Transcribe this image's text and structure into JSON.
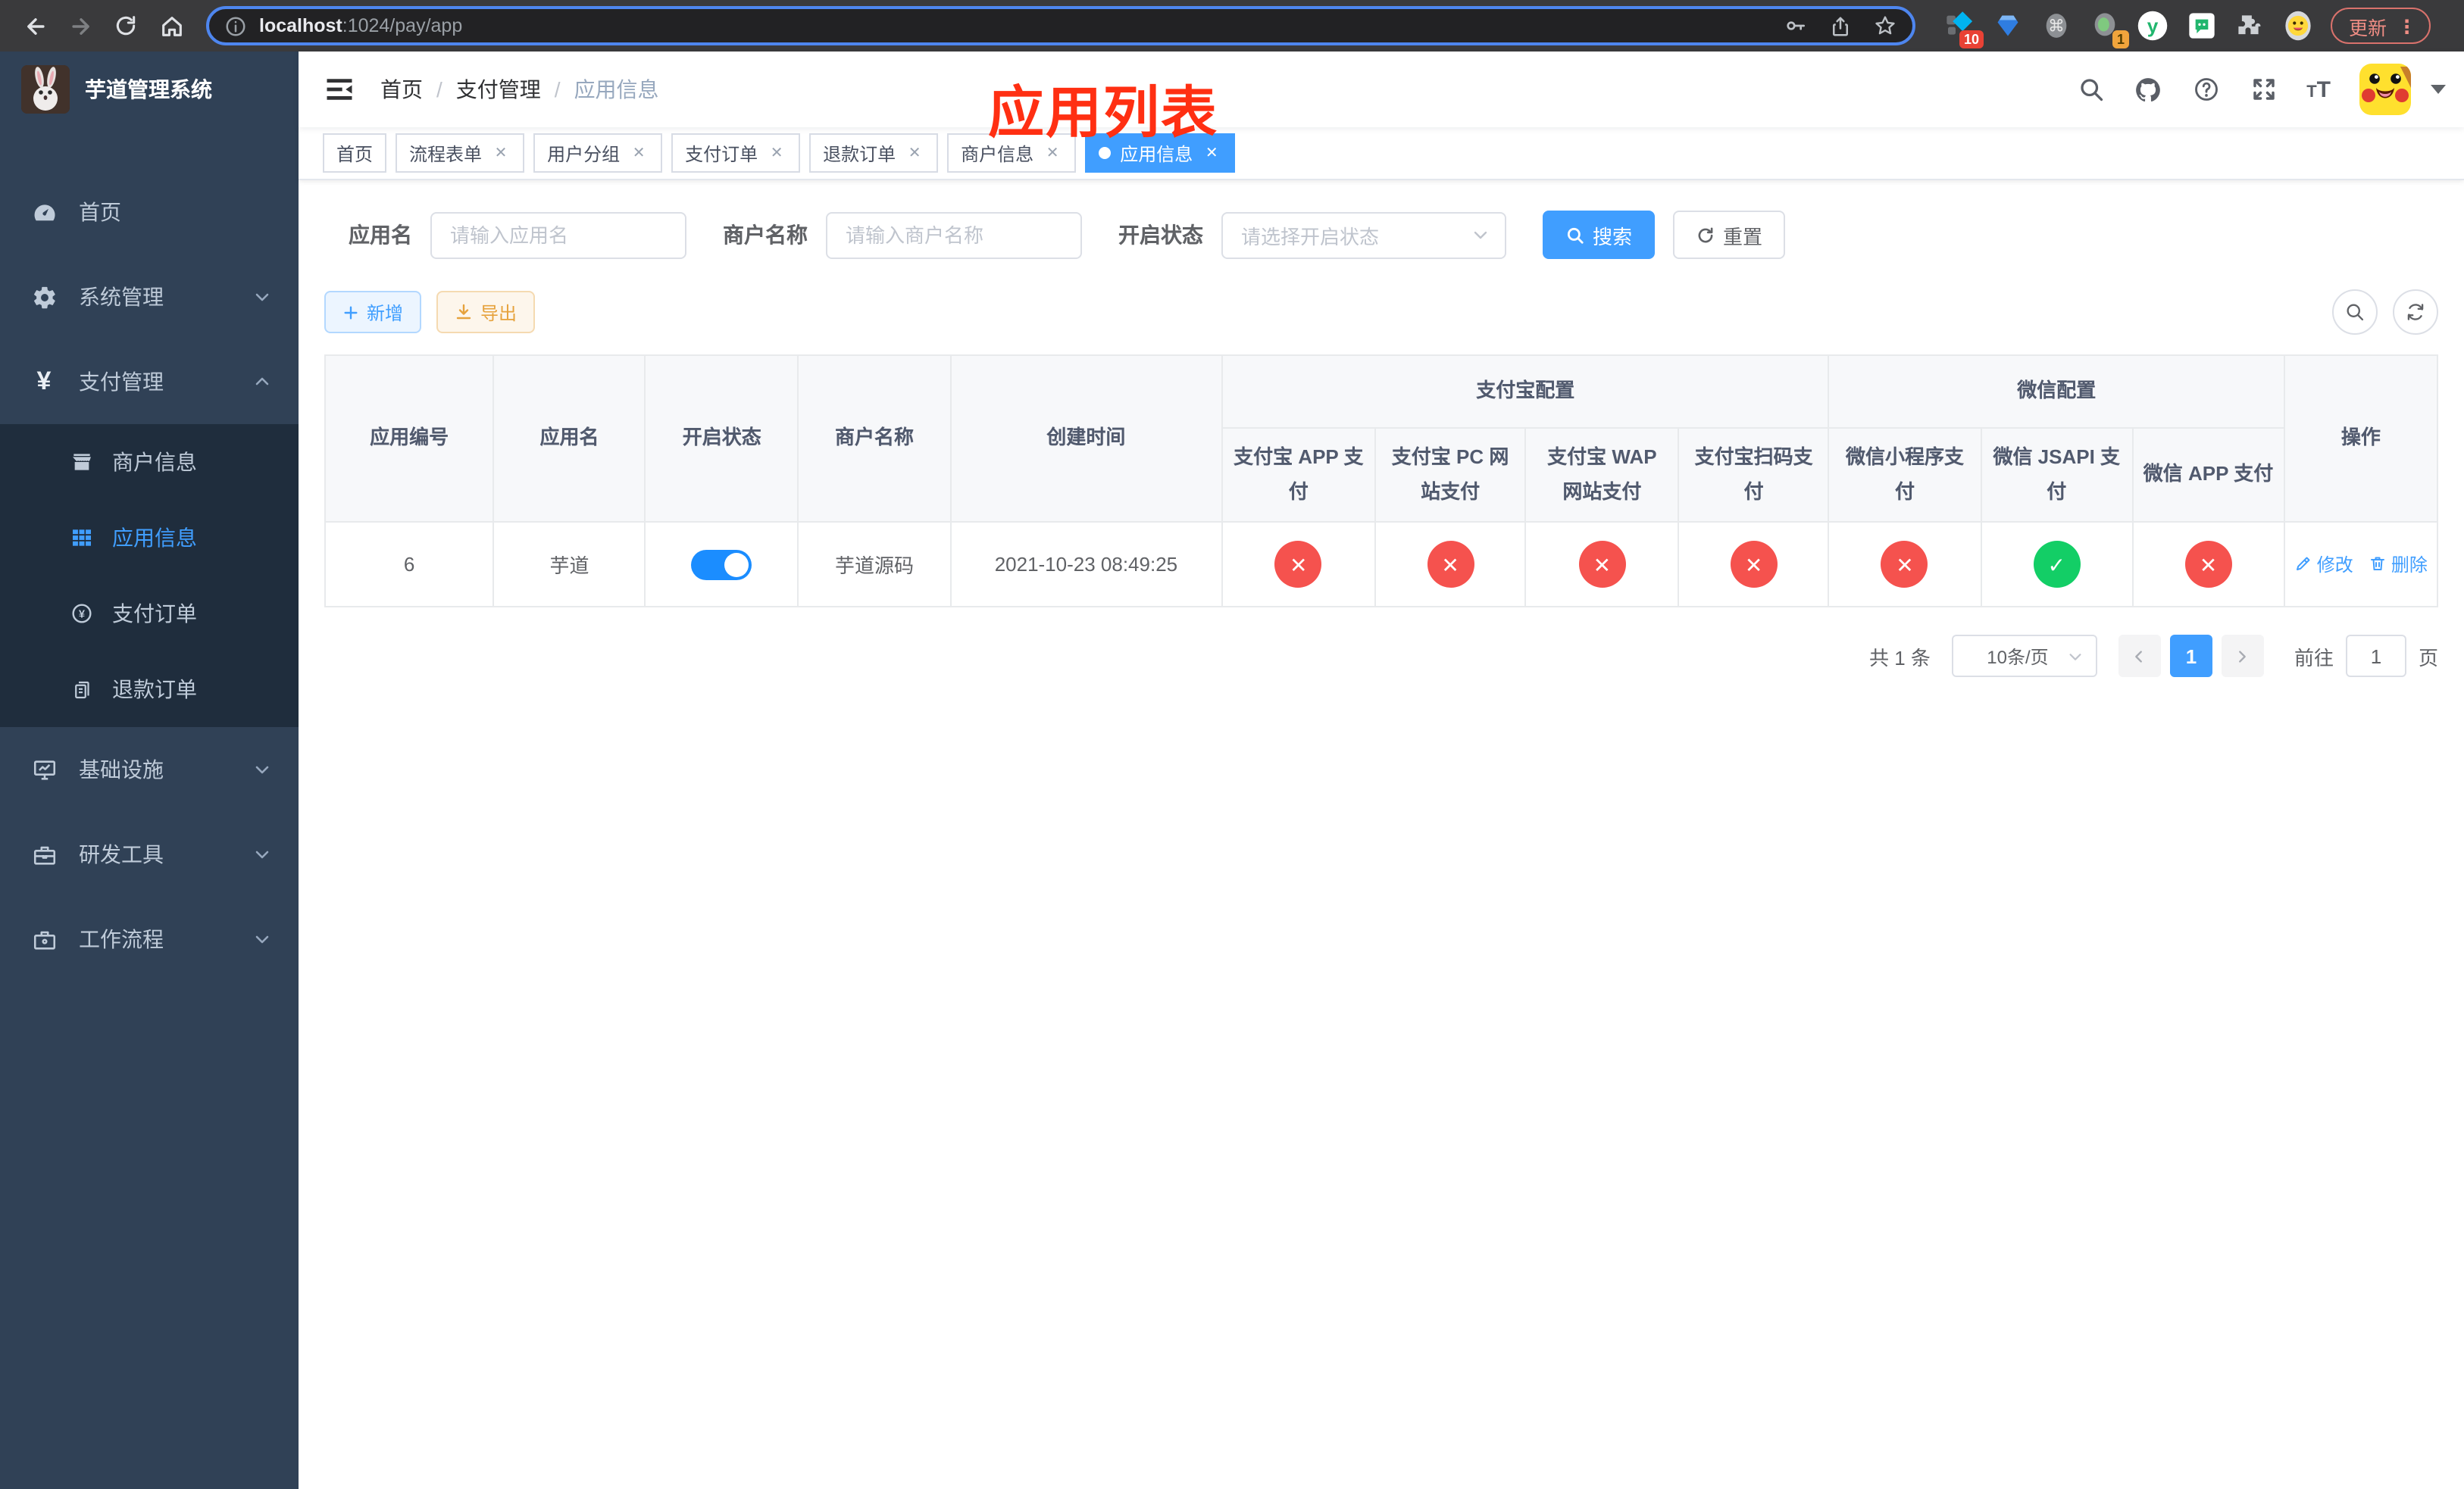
{
  "browser": {
    "url_host": "localhost",
    "url_rest": ":1024/pay/app",
    "update_label": "更新",
    "menu_dots": "⋮",
    "ext_badge_pin": "10",
    "ext_badge_one": "1"
  },
  "colors": {
    "accent": "#409eff",
    "success": "#13ce66",
    "danger": "#f5524e",
    "warning": "#e6a23c",
    "sidebar_bg": "#304156",
    "submenu_bg": "#1f2d3d",
    "annotation_red": "#ff2f12"
  },
  "sidebar": {
    "system_title": "芋道管理系统",
    "items": [
      {
        "label": "首页",
        "icon": "dashboard-icon",
        "chevron": null,
        "expanded": false
      },
      {
        "label": "系统管理",
        "icon": "gear-icon",
        "chevron": "down",
        "expanded": false
      },
      {
        "label": "支付管理",
        "icon": "yen-icon",
        "chevron": "up",
        "expanded": true
      },
      {
        "label": "基础设施",
        "icon": "infrastructure-icon",
        "chevron": "down",
        "expanded": false
      },
      {
        "label": "研发工具",
        "icon": "devtools-icon",
        "chevron": "down",
        "expanded": false
      },
      {
        "label": "工作流程",
        "icon": "workflow-icon",
        "chevron": "down",
        "expanded": false
      }
    ],
    "submenu": [
      {
        "label": "商户信息",
        "icon": "merchant-icon",
        "active": false
      },
      {
        "label": "应用信息",
        "icon": "app-grid-icon",
        "active": true
      },
      {
        "label": "支付订单",
        "icon": "pay-order-icon",
        "active": false
      },
      {
        "label": "退款订单",
        "icon": "refund-order-icon",
        "active": false
      }
    ]
  },
  "header": {
    "breadcrumb": [
      "首页",
      "支付管理",
      "应用信息"
    ],
    "annotation_title": "应用列表"
  },
  "tabs": [
    {
      "label": "首页",
      "closable": false,
      "active": false
    },
    {
      "label": "流程表单",
      "closable": true,
      "active": false
    },
    {
      "label": "用户分组",
      "closable": true,
      "active": false
    },
    {
      "label": "支付订单",
      "closable": true,
      "active": false
    },
    {
      "label": "退款订单",
      "closable": true,
      "active": false
    },
    {
      "label": "商户信息",
      "closable": true,
      "active": false
    },
    {
      "label": "应用信息",
      "closable": true,
      "active": true
    }
  ],
  "filters": {
    "app_name_label": "应用名",
    "app_name_placeholder": "请输入应用名",
    "merchant_label": "商户名称",
    "merchant_placeholder": "请输入商户名称",
    "status_label": "开启状态",
    "status_placeholder": "请选择开启状态",
    "search_label": "搜索",
    "reset_label": "重置"
  },
  "toolbar": {
    "add_label": "新增",
    "export_label": "导出"
  },
  "table": {
    "simple_columns": [
      "应用编号",
      "应用名",
      "开启状态",
      "商户名称",
      "创建时间"
    ],
    "groups": [
      {
        "label": "支付宝配置",
        "children": [
          "支付宝 APP 支付",
          "支付宝 PC 网站支付",
          "支付宝 WAP 网站支付",
          "支付宝扫码支付"
        ]
      },
      {
        "label": "微信配置",
        "children": [
          "微信小程序支付",
          "微信 JSAPI 支付",
          "微信 APP 支付"
        ]
      }
    ],
    "ops_column": "操作",
    "row": {
      "id": "6",
      "name": "芋道",
      "enabled": true,
      "merchant": "芋道源码",
      "created_at": "2021-10-23 08:49:25",
      "configs": [
        "no",
        "no",
        "no",
        "no",
        "no",
        "ok",
        "no"
      ],
      "edit_label": "修改",
      "delete_label": "删除"
    }
  },
  "pagination": {
    "total": "共 1 条",
    "page_size": "10条/页",
    "current_page": "1",
    "goto_label": "前往",
    "goto_value": "1",
    "page_unit": "页"
  }
}
